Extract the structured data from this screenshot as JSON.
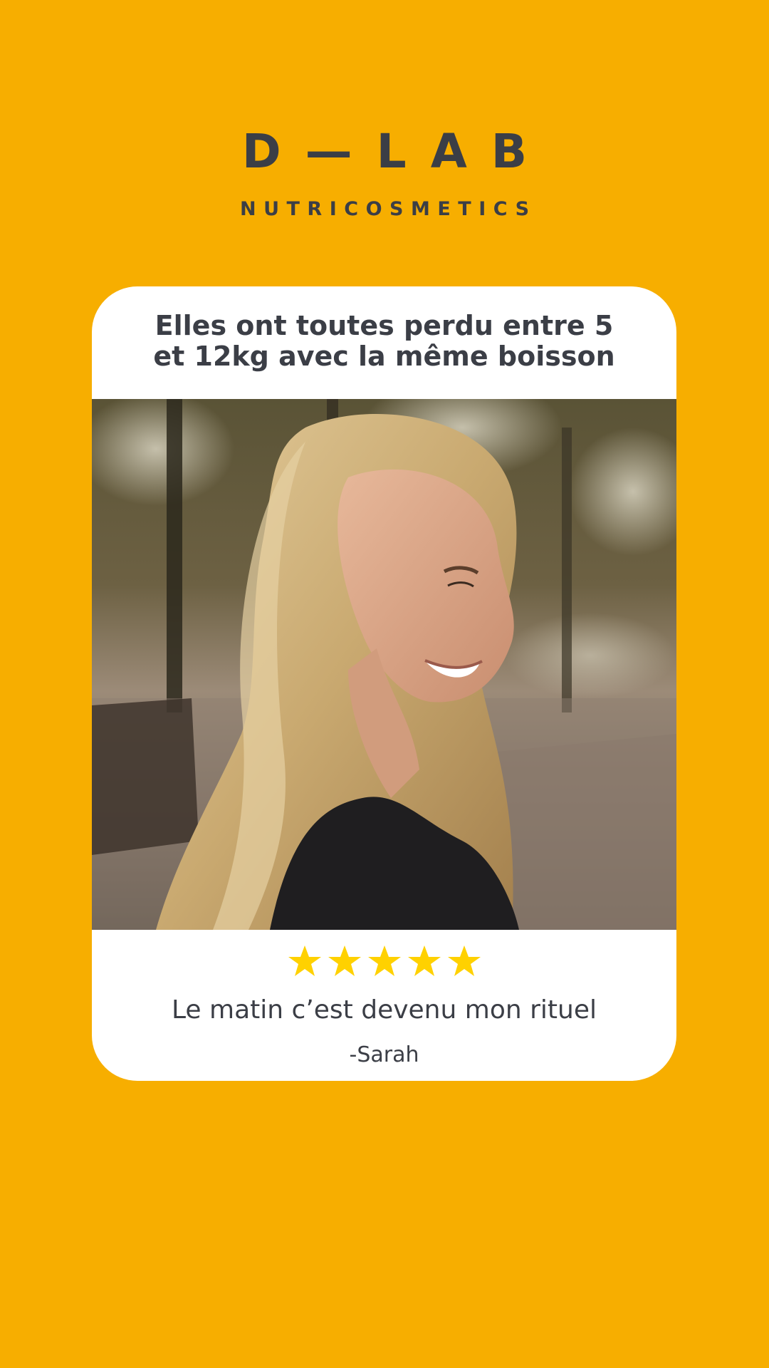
{
  "brand": {
    "name": "D—LAB",
    "subtitle": "NUTRICOSMETICS"
  },
  "card": {
    "headline_line_1": "Elles ont toutes perdu entre 5",
    "headline_line_2": "et 12kg avec la même boisson",
    "rating": 5,
    "quote": "Le matin c’est devenu mon rituel",
    "author": "-Sarah"
  },
  "colors": {
    "background": "#F7AE00",
    "card": "#FFFFFF",
    "text": "#3B3E46",
    "star": "#FFD100"
  },
  "icons": {
    "rating_star": "star-icon"
  }
}
